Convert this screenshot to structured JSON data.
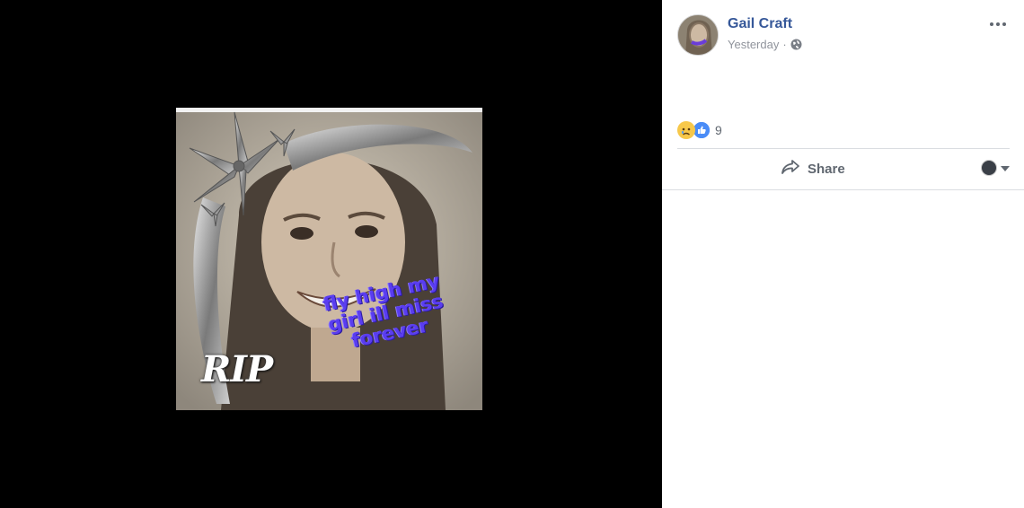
{
  "photo": {
    "rip_text": "RIP",
    "overlay_text": "fly high my girl ill miss forever"
  },
  "post": {
    "author": "Gail Craft",
    "time": "Yesterday",
    "separator": "·",
    "privacy_icon": "globe-icon",
    "more_icon": "more-options-icon"
  },
  "reactions": {
    "icons": [
      "sad-reaction-icon",
      "like-reaction-icon"
    ],
    "count": "9"
  },
  "actions": {
    "share_label": "Share",
    "share_icon": "share-arrow-icon",
    "audience_icon": "avatar-icon",
    "dropdown_icon": "caret-down-icon"
  },
  "colors": {
    "author_link": "#365899",
    "meta_gray": "#90949c",
    "overlay_text_purple": "#5a3df0",
    "like_blue": "#4a8cf7",
    "sad_yellow": "#f7c84a"
  }
}
